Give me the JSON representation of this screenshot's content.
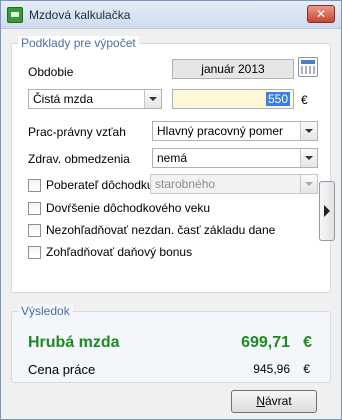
{
  "window": {
    "title": "Mzdová kalkulačka",
    "close_glyph": "✕"
  },
  "inputs_group": {
    "title": "Podklady pre výpočet",
    "period_label": "Obdobie",
    "period_value": "január 2013",
    "calendar_icon": "calendar-icon",
    "wage_type": "Čistá mzda",
    "amount": "550",
    "currency": "€",
    "employment_label": "Prac-právny vzťah",
    "employment_value": "Hlavný pracovný pomer",
    "health_label": "Zdrav. obmedzenia",
    "health_value": "nemá",
    "pension_label": "Poberateľ dôchodku",
    "pension_value": "starobného",
    "checkboxes": [
      "Dovŕšenie dôchodkového veku",
      "Nezohľadňovať nezdan. časť základu dane",
      "Zohľadňovať daňový bonus"
    ]
  },
  "result_group": {
    "title": "Výsledok",
    "gross_label": "Hrubá mzda",
    "gross_value": "699,71",
    "gross_currency": "€",
    "cost_label": "Cena práce",
    "cost_value": "945,96",
    "cost_currency": "€"
  },
  "footer": {
    "return_prefix": "",
    "return_underlined": "N",
    "return_rest": "ávrat"
  },
  "colors": {
    "accent": "#4a6fa5",
    "result_green": "#1f8a22",
    "amount_bg": "#fff8d6"
  }
}
